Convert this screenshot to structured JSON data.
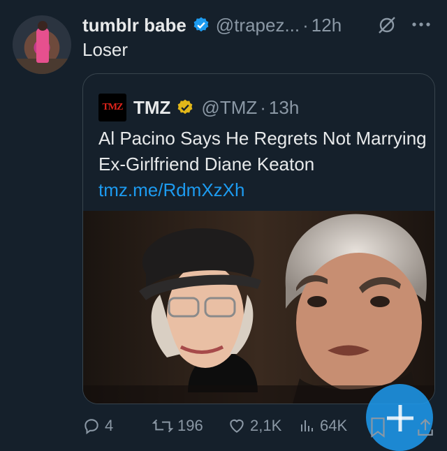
{
  "tweet": {
    "author_name": "tumblr babe",
    "handle": "@trapez...",
    "separator": "·",
    "time": "12h",
    "text": "Loser"
  },
  "quote": {
    "logo_text": "TMZ",
    "author_name": "TMZ",
    "handle": "@TMZ",
    "separator": "·",
    "time": "13h",
    "text": "Al Pacino Says He Regrets Not Marrying Ex-Girlfriend Diane Keaton",
    "link": "tmz.me/RdmXzXh"
  },
  "actions": {
    "replies": "4",
    "reposts": "196",
    "likes": "2,1K",
    "views": "64K"
  },
  "icons": [
    "verified-badge-icon",
    "gold-verified-badge-icon",
    "grok-icon",
    "more-icon",
    "reply-icon",
    "repost-icon",
    "like-icon",
    "views-icon",
    "bookmark-icon",
    "share-icon",
    "compose-plus-icon"
  ],
  "colors": {
    "background": "#15202b",
    "text": "#e7e9ea",
    "secondary_text": "#8b98a5",
    "link": "#1d9bf0",
    "verified_blue": "#1d9bf0",
    "verified_gold": "#e2b719",
    "border": "#38444d"
  }
}
